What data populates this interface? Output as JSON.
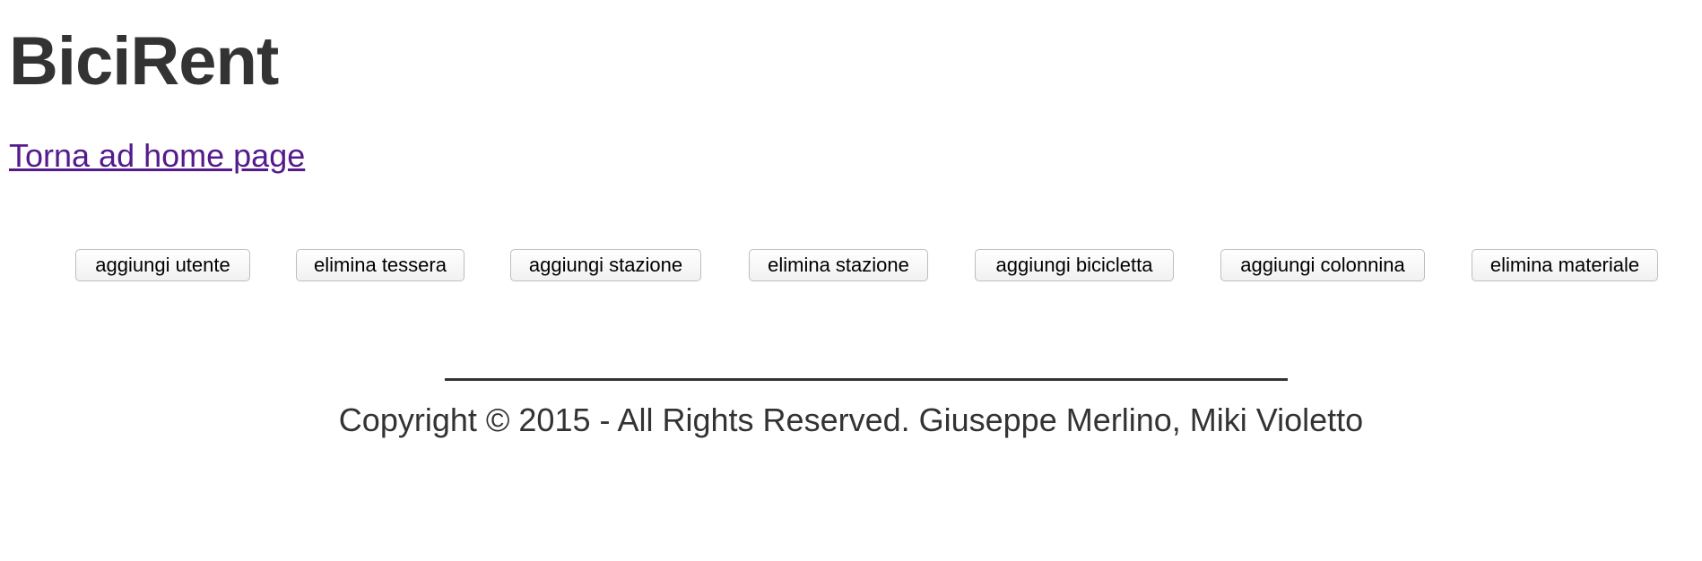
{
  "header": {
    "title": "BiciRent"
  },
  "nav": {
    "home_link": "Torna ad home page"
  },
  "admin_actions": [
    {
      "label": "aggiungi utente"
    },
    {
      "label": "elimina tessera"
    },
    {
      "label": "aggiungi stazione"
    },
    {
      "label": "elimina stazione"
    },
    {
      "label": "aggiungi bicicletta"
    },
    {
      "label": "aggiungi colonnina"
    },
    {
      "label": "elimina materiale"
    }
  ],
  "footer": {
    "copyright": "Copyright © 2015 - All Rights Reserved. Giuseppe Merlino, Miki Violetto"
  },
  "colors": {
    "text": "#333333",
    "visited_link": "#551a8b",
    "background": "#ffffff"
  }
}
